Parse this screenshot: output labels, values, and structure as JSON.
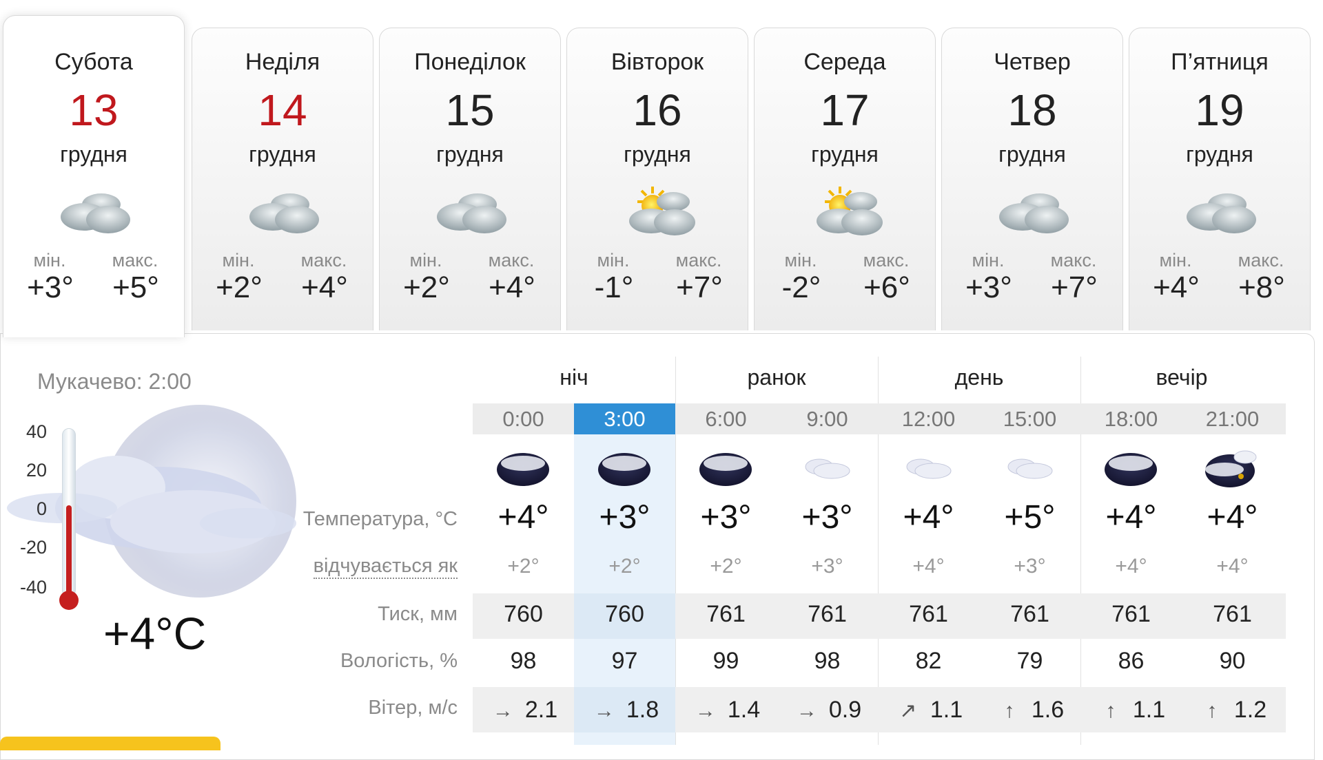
{
  "days": [
    {
      "name": "Субота",
      "num": "13",
      "month": "грудня",
      "min_label": "мін.",
      "max_label": "макс.",
      "min": "+3°",
      "max": "+5°",
      "weekend": true,
      "icon": "cloudy-icon"
    },
    {
      "name": "Неділя",
      "num": "14",
      "month": "грудня",
      "min_label": "мін.",
      "max_label": "макс.",
      "min": "+2°",
      "max": "+4°",
      "weekend": true,
      "icon": "cloudy-icon"
    },
    {
      "name": "Понеділок",
      "num": "15",
      "month": "грудня",
      "min_label": "мін.",
      "max_label": "макс.",
      "min": "+2°",
      "max": "+4°",
      "weekend": false,
      "icon": "cloudy-icon"
    },
    {
      "name": "Вівторок",
      "num": "16",
      "month": "грудня",
      "min_label": "мін.",
      "max_label": "макс.",
      "min": "-1°",
      "max": "+7°",
      "weekend": false,
      "icon": "partly-cloudy-icon"
    },
    {
      "name": "Середа",
      "num": "17",
      "month": "грудня",
      "min_label": "мін.",
      "max_label": "макс.",
      "min": "-2°",
      "max": "+6°",
      "weekend": false,
      "icon": "partly-cloudy-icon"
    },
    {
      "name": "Четвер",
      "num": "18",
      "month": "грудня",
      "min_label": "мін.",
      "max_label": "макс.",
      "min": "+3°",
      "max": "+7°",
      "weekend": false,
      "icon": "cloudy-icon"
    },
    {
      "name": "П’ятниця",
      "num": "19",
      "month": "грудня",
      "min_label": "мін.",
      "max_label": "макс.",
      "min": "+4°",
      "max": "+8°",
      "weekend": false,
      "icon": "cloudy-icon"
    }
  ],
  "current": {
    "city_time": "Мукачево: 2:00",
    "temp": "+4°C",
    "scale": [
      "40",
      "20",
      "0",
      "-20",
      "-40"
    ],
    "thermometer_level_c": 4
  },
  "periods": [
    "ніч",
    "ранок",
    "день",
    "вечір"
  ],
  "hours": [
    "0:00",
    "3:00",
    "6:00",
    "9:00",
    "12:00",
    "15:00",
    "18:00",
    "21:00"
  ],
  "selected_hour": "3:00",
  "labels": {
    "temp": "Температура, °C",
    "feels": "відчувається як",
    "pressure": "Тиск, мм",
    "humidity": "Вологість, %",
    "wind": "Вітер, м/с"
  },
  "hourly": {
    "icons": [
      "night-cloudy-icon",
      "night-cloudy-icon",
      "night-cloudy-icon",
      "light-cloud-icon",
      "light-cloud-icon",
      "light-cloud-icon",
      "night-cloudy-icon",
      "night-cloudy-moon-icon"
    ],
    "temp": [
      "+4°",
      "+3°",
      "+3°",
      "+3°",
      "+4°",
      "+5°",
      "+4°",
      "+4°"
    ],
    "feels": [
      "+2°",
      "+2°",
      "+2°",
      "+3°",
      "+4°",
      "+3°",
      "+4°",
      "+4°"
    ],
    "pressure": [
      "760",
      "760",
      "761",
      "761",
      "761",
      "761",
      "761",
      "761"
    ],
    "humidity": [
      "98",
      "97",
      "99",
      "98",
      "82",
      "79",
      "86",
      "90"
    ],
    "wind_arrows": [
      "→",
      "→",
      "→",
      "→",
      "↗",
      "↑",
      "↑",
      "↑"
    ],
    "wind": [
      "2.1",
      "1.8",
      "1.4",
      "0.9",
      "1.1",
      "1.6",
      "1.1",
      "1.2"
    ]
  },
  "colors": {
    "weekend": "#c0181d",
    "selected": "#2f8fd6",
    "thermometer": "#c51f1f"
  }
}
